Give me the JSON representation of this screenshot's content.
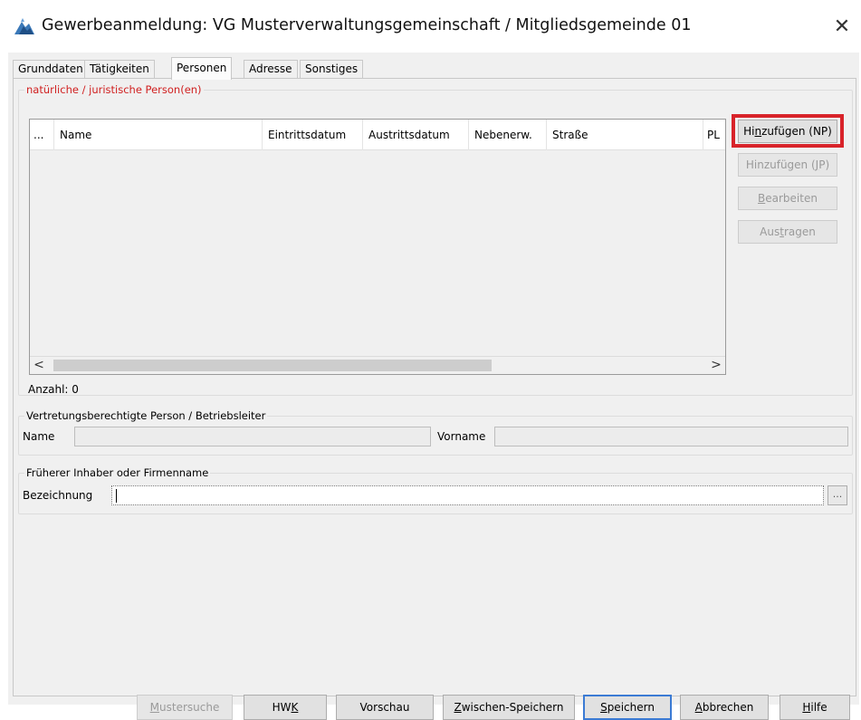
{
  "window": {
    "title": "Gewerbeanmeldung: VG Musterverwaltungsgemeinschaft / Mitgliedsgemeinde 01",
    "close_glyph": "✕"
  },
  "tabs": [
    {
      "label": "Grunddaten"
    },
    {
      "label": "Tätigkeiten"
    },
    {
      "label": "Personen",
      "active": true
    },
    {
      "label": "Adresse"
    },
    {
      "label": "Sonstiges"
    }
  ],
  "persons_group": {
    "title": "natürliche / juristische Person(en)",
    "columns": [
      "...",
      "Name",
      "Eintrittsdatum",
      "Austrittsdatum",
      "Nebenerw.",
      "Straße",
      "PL"
    ],
    "rows": [],
    "scroll_left": "<",
    "scroll_right": ">",
    "count_label": "Anzahl:",
    "count_value": "0",
    "buttons": {
      "add_np": {
        "pre": "Hi",
        "mn": "n",
        "post": "zufügen (NP)"
      },
      "add_jp": {
        "pre": "Hinzufügen (",
        "mn": "J",
        "post": "P)"
      },
      "edit": {
        "pre": "",
        "mn": "B",
        "post": "earbeiten"
      },
      "remove": {
        "pre": "Aus",
        "mn": "t",
        "post": "ragen"
      }
    }
  },
  "representative_group": {
    "title": "Vertretungsberechtigte Person / Betriebsleiter",
    "name_label": "Name",
    "name_value": "",
    "firstname_label": "Vorname",
    "firstname_value": ""
  },
  "former_owner_group": {
    "title": "Früherer Inhaber oder Firmenname",
    "designation_label": "Bezeichnung",
    "designation_value": "",
    "dots_label": "..."
  },
  "footer": {
    "mustersuche": {
      "pre": "",
      "mn": "M",
      "post": "ustersuche"
    },
    "hwk": {
      "pre": "HW",
      "mn": "K",
      "post": ""
    },
    "vorschau": {
      "pre": "Vorschau",
      "mn": "",
      "post": ""
    },
    "zwischen": {
      "pre": "",
      "mn": "Z",
      "post": "wischen-Speichern"
    },
    "speichern": {
      "pre": "",
      "mn": "S",
      "post": "peichern"
    },
    "abbrechen": {
      "pre": "",
      "mn": "A",
      "post": "bbrechen"
    },
    "hilfe": {
      "pre": "",
      "mn": "H",
      "post": "ilfe"
    }
  },
  "colors": {
    "highlight": "#d8232a",
    "group_title_red": "#d01f1f"
  }
}
